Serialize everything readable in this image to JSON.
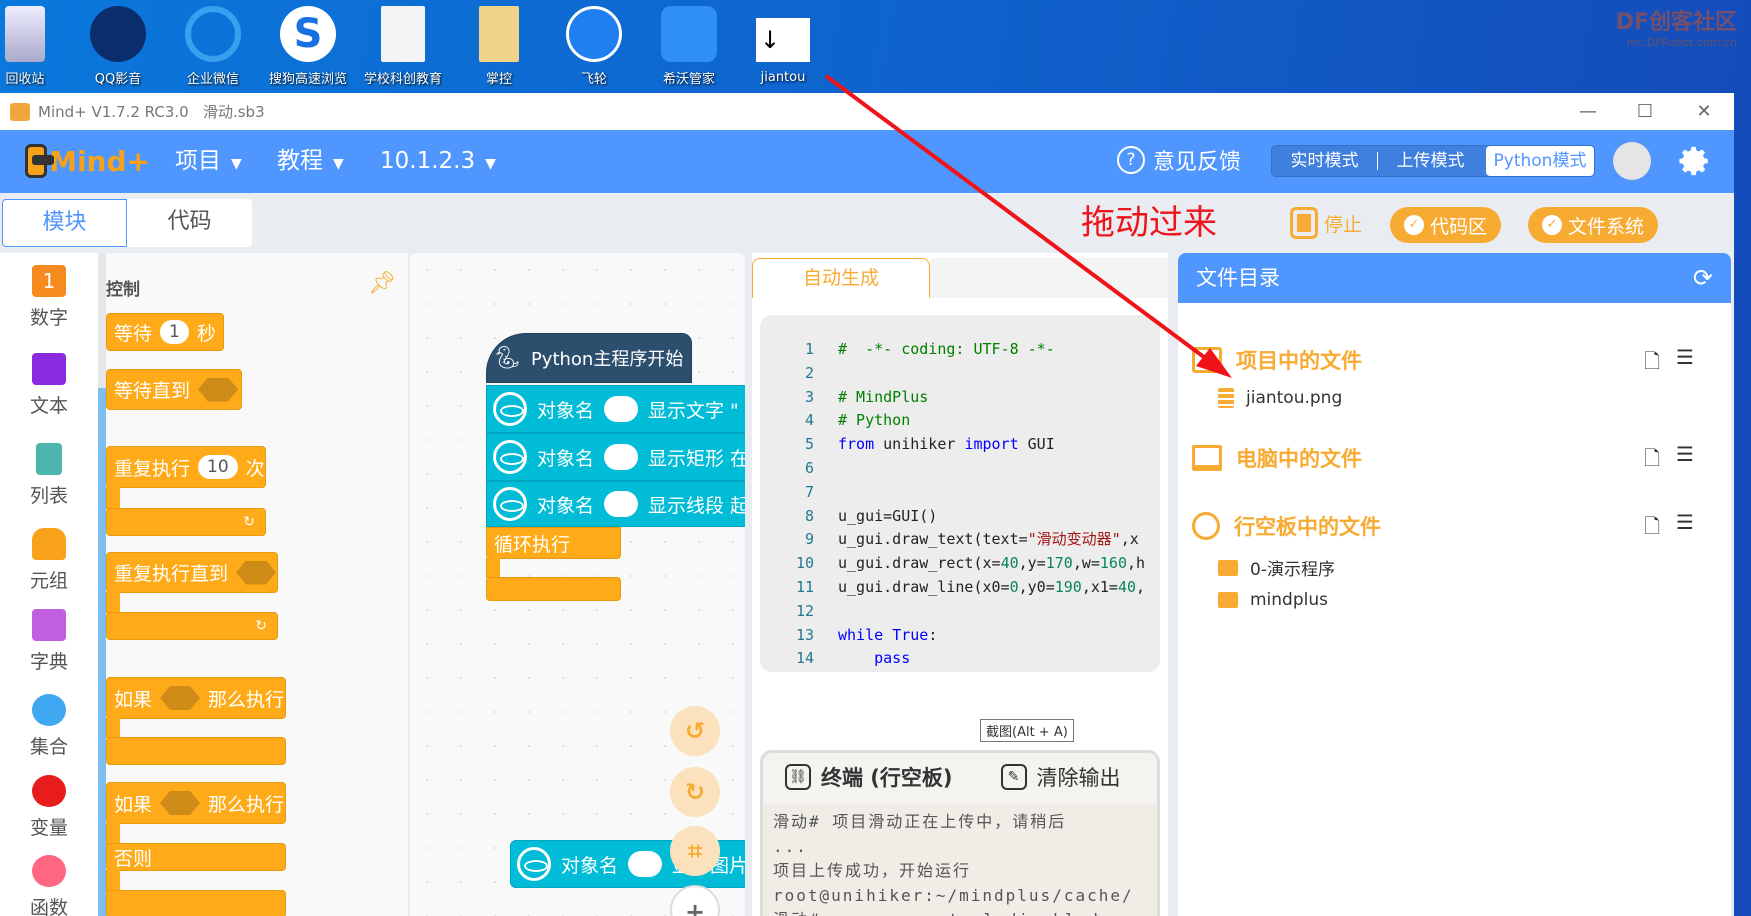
{
  "desktop": {
    "icons": [
      {
        "label": "回收站",
        "icon": "recycle-bin-icon"
      },
      {
        "label": "QQ影音",
        "icon": "qq-player-icon"
      },
      {
        "label": "企业微信",
        "icon": "wecom-icon"
      },
      {
        "label": "搜狗高速浏览",
        "icon": "sogou-browser-icon"
      },
      {
        "label": "学校科创教育",
        "icon": "word-document-icon"
      },
      {
        "label": "掌控",
        "icon": "folder-document-icon"
      },
      {
        "label": "飞轮",
        "icon": "flywheel-icon"
      },
      {
        "label": "希沃管家",
        "icon": "shield-icon"
      },
      {
        "label": "jiantou",
        "icon": "arrow-image-icon"
      }
    ],
    "watermark": {
      "title": "DF创客社区",
      "url": "mc.DFRobot.com.cn"
    }
  },
  "window": {
    "title": "Mind+ V1.7.2 RC3.0   滑动.sb3",
    "controls": {
      "minimize": "—",
      "maximize": "☐",
      "close": "✕"
    }
  },
  "header": {
    "logo": "Mind+",
    "menus": [
      {
        "label": "项目"
      },
      {
        "label": "教程"
      },
      {
        "label": "10.1.2.3"
      }
    ],
    "feedback": "意见反馈",
    "modes": [
      {
        "label": "实时模式"
      },
      {
        "label": "上传模式"
      },
      {
        "label": "Python模式",
        "active": true
      }
    ]
  },
  "toolbar": {
    "tabs": [
      {
        "label": "模块",
        "active": true
      },
      {
        "label": "代码"
      }
    ],
    "annotation": "拖动过来",
    "stop": "停止",
    "code_area": "代码区",
    "file_system": "文件系统"
  },
  "categories": [
    {
      "label": "数字",
      "color": "#f58a1f"
    },
    {
      "label": "文本",
      "color": "#8a2be2"
    },
    {
      "label": "列表",
      "color": "#4db6ac"
    },
    {
      "label": "元组",
      "color": "#f7a21a"
    },
    {
      "label": "字典",
      "color": "#c060e0"
    },
    {
      "label": "集合",
      "color": "#40a8f0"
    },
    {
      "label": "变量",
      "color": "#e81c1c"
    },
    {
      "label": "函数",
      "color": "#ff6680"
    }
  ],
  "palette": {
    "section": "控制",
    "blocks": {
      "wait": {
        "pre": "等待",
        "value": "1",
        "post": "秒"
      },
      "wait_until": "等待直到",
      "repeat": {
        "pre": "重复执行",
        "value": "10",
        "post": "次"
      },
      "repeat_until": "重复执行直到",
      "if_then": {
        "pre": "如果",
        "post": "那么执行"
      },
      "if_else": {
        "pre": "如果",
        "post": "那么执行",
        "else": "否则"
      }
    }
  },
  "canvas": {
    "hat": "Python主程序开始",
    "blocks": [
      {
        "obj": "对象名",
        "action": "显示文字 \""
      },
      {
        "obj": "对象名",
        "action": "显示矩形 在X"
      },
      {
        "obj": "对象名",
        "action": "显示线段 起点"
      }
    ],
    "loop": "循环执行",
    "loose_block": {
      "obj": "对象名",
      "action": "显示图片"
    }
  },
  "code": {
    "tab": "自动生成",
    "lines": [
      {
        "n": "1",
        "html": "<span class='c-cm'>#  -*- coding: UTF-8 -*-</span>"
      },
      {
        "n": "2",
        "html": ""
      },
      {
        "n": "3",
        "html": "<span class='c-cm'># MindPlus</span>"
      },
      {
        "n": "4",
        "html": "<span class='c-cm'># Python</span>"
      },
      {
        "n": "5",
        "html": "<span class='c-kw'>from</span> unihiker <span class='c-kw'>import</span> GUI"
      },
      {
        "n": "6",
        "html": ""
      },
      {
        "n": "7",
        "html": ""
      },
      {
        "n": "8",
        "html": "u_gui=GUI()"
      },
      {
        "n": "9",
        "html": "u_gui.draw_text(text=<span class='c-str'>\"滑动变动器\"</span>,x"
      },
      {
        "n": "10",
        "html": "u_gui.draw_rect(x=<span class='c-num'>40</span>,y=<span class='c-num'>170</span>,w=<span class='c-num'>160</span>,h"
      },
      {
        "n": "11",
        "html": "u_gui.draw_line(x0=<span class='c-num'>0</span>,y0=<span class='c-num'>190</span>,x1=<span class='c-num'>40</span>,"
      },
      {
        "n": "12",
        "html": ""
      },
      {
        "n": "13",
        "html": "<span class='c-kw'>while</span> <span class='c-kw'>True</span>:"
      },
      {
        "n": "14",
        "html": "    <span class='c-kw'>pass</span>"
      },
      {
        "n": "15",
        "html": ""
      }
    ]
  },
  "terminal": {
    "title": "终端 (行空板)",
    "clear": "清除输出",
    "tooltip": "截图(Alt + A)",
    "lines": [
      "滑动# 项目滑动正在上传中，请稍后",
      "...",
      "项目上传成功，开始运行",
      "root@unihiker:~/mindplus/cache/",
      "滑动# access control disabled, c"
    ]
  },
  "files": {
    "title": "文件目录",
    "sections": [
      {
        "label": "项目中的文件",
        "items": [
          "jiantou.png"
        ]
      },
      {
        "label": "电脑中的文件",
        "items": []
      },
      {
        "label": "行空板中的文件",
        "items": [
          "0-演示程序",
          "mindplus"
        ]
      }
    ]
  },
  "colors": {
    "brand_blue": "#4f96ff",
    "accent_orange": "#f7ab33",
    "block_orange": "#ffab19",
    "block_cyan": "#00bcd6",
    "annotation_red": "#f0141a"
  }
}
